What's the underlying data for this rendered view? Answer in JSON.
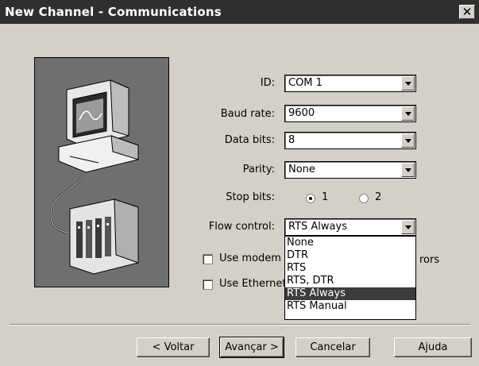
{
  "window": {
    "title": "New Channel - Communications",
    "close_glyph": "✕"
  },
  "form": {
    "id": {
      "label": "ID:",
      "value": "COM 1"
    },
    "baud_rate": {
      "label": "Baud rate:",
      "value": "9600"
    },
    "data_bits": {
      "label": "Data bits:",
      "value": "8"
    },
    "parity": {
      "label": "Parity:",
      "value": "None"
    },
    "stop_bits": {
      "label": "Stop bits:",
      "options": [
        "1",
        "2"
      ],
      "selected": "1"
    },
    "flow_control": {
      "label": "Flow control:",
      "value": "RTS Always",
      "options": [
        "None",
        "DTR",
        "RTS",
        "RTS, DTR",
        "RTS Always",
        "RTS Manual"
      ],
      "highlighted": "RTS Always"
    },
    "use_modem": {
      "label": "Use modem",
      "trailing_text": "rors",
      "checked": false
    },
    "use_ethernet": {
      "label": "Use Ethernet",
      "checked": false
    }
  },
  "buttons": {
    "back": "< Voltar",
    "next": "Avançar >",
    "cancel": "Cancelar",
    "help": "Ajuda"
  },
  "colors": {
    "titlebar": "#2f2f2f",
    "dialog": "#d4d0c8",
    "highlight": "#3c3c3c",
    "illustration_bg": "#6f6f6f"
  }
}
